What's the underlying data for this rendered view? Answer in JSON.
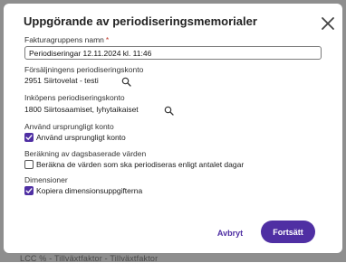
{
  "background": {
    "partial_text": "LCC % - Tillväxtfaktor - Tillväxtfaktor"
  },
  "dialog": {
    "title": "Uppgörande av periodiseringsmemorialer",
    "fields": {
      "invoice_group_name": {
        "label": "Fakturagruppens namn",
        "required_marker": "*",
        "value": "Periodiseringar 12.11.2024 kl. 11:46"
      },
      "sales_account": {
        "label": "Försäljningens periodiseringskonto",
        "value": "2951 Siirtovelat - testi"
      },
      "purchase_account": {
        "label": "Inköpens periodiseringskonto",
        "value": "1800 Siirtosaamiset, lyhytaikaiset"
      },
      "use_original_account": {
        "label": "Använd ursprungligt konto",
        "checkbox_label": "Använd ursprungligt konto",
        "checked": true
      },
      "day_based_calc": {
        "label": "Beräkning av dagsbaserade värden",
        "checkbox_label": "Beräkna de värden som ska periodiseras enligt antalet dagar",
        "checked": false
      },
      "dimensions": {
        "label": "Dimensioner",
        "checkbox_label": "Kopiera dimensionsuppgifterna",
        "checked": true
      }
    },
    "buttons": {
      "cancel": "Avbryt",
      "continue": "Fortsätt"
    }
  },
  "colors": {
    "accent": "#4f2fa3",
    "required": "#c0392b",
    "backdrop": "#8e8e8e"
  }
}
